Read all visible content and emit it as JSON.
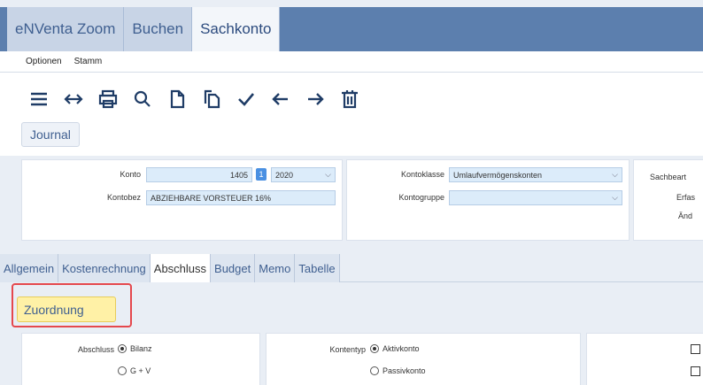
{
  "title_tabs": [
    "eNVenta Zoom",
    "Buchen",
    "Sachkonto"
  ],
  "menu": [
    "Optionen",
    "Stamm"
  ],
  "toolbar_icons": [
    "menu-icon",
    "swap-icon",
    "print-icon",
    "search-icon",
    "new-document-icon",
    "copy-icon",
    "check-icon",
    "arrow-left-icon",
    "arrow-right-icon",
    "delete-icon"
  ],
  "journal_label": "Journal",
  "header": {
    "konto_label": "Konto",
    "konto_value": "1405",
    "badge": "1",
    "year_value": "2020",
    "kontobez_label": "Kontobez",
    "kontobez_value": "ABZIEHBARE VORSTEUER 16%",
    "kontoklasse_label": "Kontoklasse",
    "kontoklasse_value": "Umlaufvermögenskonten",
    "kontogruppe_label": "Kontogruppe",
    "kontogruppe_value": "",
    "sachbearb_label": "Sachbeart",
    "erfas_label": "Erfas",
    "aend_label": "Änd"
  },
  "content_tabs": [
    "Allgemein",
    "Kostenrechnung",
    "Abschluss",
    "Budget",
    "Memo",
    "Tabelle"
  ],
  "zuordnung_label": "Zuordnung",
  "abschluss": {
    "label": "Abschluss",
    "opt1": "Bilanz",
    "opt2": "G + V",
    "kontentyp_label": "Kontentyp",
    "kopt1": "Aktivkonto",
    "kopt2": "Passivkonto"
  }
}
